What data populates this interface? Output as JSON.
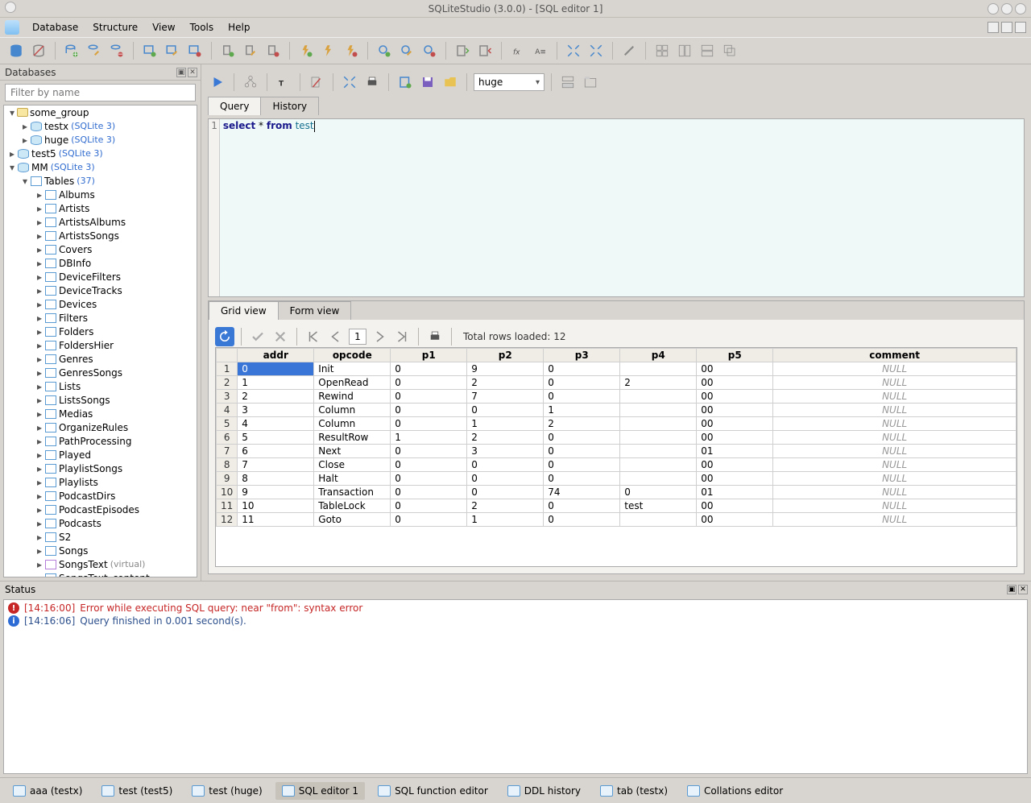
{
  "window": {
    "title": "SQLiteStudio (3.0.0) - [SQL editor 1]"
  },
  "menu": {
    "database": "Database",
    "structure": "Structure",
    "view": "View",
    "tools": "Tools",
    "help": "Help"
  },
  "sidebar": {
    "title": "Databases",
    "filter_placeholder": "Filter by name",
    "group": {
      "name": "some_group"
    },
    "dbs": {
      "testx": {
        "name": "testx",
        "driver": "(SQLite 3)"
      },
      "huge": {
        "name": "huge",
        "driver": "(SQLite 3)"
      },
      "test5": {
        "name": "test5",
        "driver": "(SQLite 3)"
      },
      "mm": {
        "name": "MM",
        "driver": "(SQLite 3)"
      }
    },
    "tables_label": "Tables",
    "tables_count": "(37)",
    "tables": [
      "Albums",
      "Artists",
      "ArtistsAlbums",
      "ArtistsSongs",
      "Covers",
      "DBInfo",
      "DeviceFilters",
      "DeviceTracks",
      "Devices",
      "Filters",
      "Folders",
      "FoldersHier",
      "Genres",
      "GenresSongs",
      "Lists",
      "ListsSongs",
      "Medias",
      "OrganizeRules",
      "PathProcessing",
      "Played",
      "PlaylistSongs",
      "Playlists",
      "PodcastDirs",
      "PodcastEpisodes",
      "Podcasts",
      "S2",
      "Songs",
      "SongsText",
      "SongsText_content"
    ],
    "virtual_suffix": "(virtual)"
  },
  "editor": {
    "combo_value": "huge",
    "tab_query": "Query",
    "tab_history": "History",
    "sql_line": "1",
    "sql_select": "select",
    "sql_star": " * ",
    "sql_from": "from",
    "sql_table": " test"
  },
  "results": {
    "tab_grid": "Grid view",
    "tab_form": "Form view",
    "page": "1",
    "total_label": "Total rows loaded: 12",
    "null_text": "NULL",
    "columns": [
      "addr",
      "opcode",
      "p1",
      "p2",
      "p3",
      "p4",
      "p5",
      "comment"
    ],
    "rows": [
      [
        "0",
        "Init",
        "0",
        "9",
        "0",
        "",
        "00",
        null
      ],
      [
        "1",
        "OpenRead",
        "0",
        "2",
        "0",
        "2",
        "00",
        null
      ],
      [
        "2",
        "Rewind",
        "0",
        "7",
        "0",
        "",
        "00",
        null
      ],
      [
        "3",
        "Column",
        "0",
        "0",
        "1",
        "",
        "00",
        null
      ],
      [
        "4",
        "Column",
        "0",
        "1",
        "2",
        "",
        "00",
        null
      ],
      [
        "5",
        "ResultRow",
        "1",
        "2",
        "0",
        "",
        "00",
        null
      ],
      [
        "6",
        "Next",
        "0",
        "3",
        "0",
        "",
        "01",
        null
      ],
      [
        "7",
        "Close",
        "0",
        "0",
        "0",
        "",
        "00",
        null
      ],
      [
        "8",
        "Halt",
        "0",
        "0",
        "0",
        "",
        "00",
        null
      ],
      [
        "9",
        "Transaction",
        "0",
        "0",
        "74",
        "0",
        "01",
        null
      ],
      [
        "10",
        "TableLock",
        "0",
        "2",
        "0",
        "test",
        "00",
        null
      ],
      [
        "11",
        "Goto",
        "0",
        "1",
        "0",
        "",
        "00",
        null
      ]
    ]
  },
  "status": {
    "title": "Status",
    "lines": [
      {
        "type": "err",
        "ts": "[14:16:00]",
        "msg": "Error while executing SQL query: near \"from\": syntax error"
      },
      {
        "type": "info",
        "ts": "[14:16:06]",
        "msg": "Query finished in 0.001 second(s)."
      }
    ]
  },
  "bottom": {
    "items": [
      {
        "label": "aaa (testx)"
      },
      {
        "label": "test (test5)"
      },
      {
        "label": "test (huge)"
      },
      {
        "label": "SQL editor 1",
        "active": true
      },
      {
        "label": "SQL function editor"
      },
      {
        "label": "DDL history"
      },
      {
        "label": "tab (testx)"
      },
      {
        "label": "Collations editor"
      }
    ]
  }
}
